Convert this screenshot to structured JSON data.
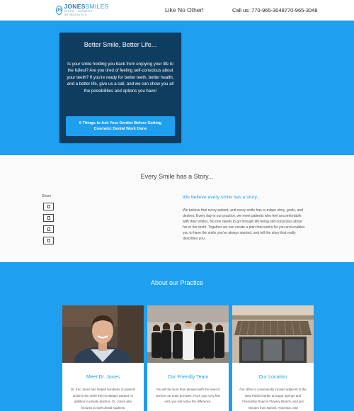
{
  "header": {
    "logo": {
      "name_bold": "JONES",
      "name_light": "SMILES",
      "tagline_small": "DENTAL · COSMETIC · ORTHODONTICS"
    },
    "tagline": "Like No Other!",
    "phone": "Call us: 770-965-3048770-965-3048"
  },
  "hero": {
    "title": "Better Smile, Better Life...",
    "text": "Is your smile holding you back from enjoying your life to the fullest? Are you tired of feeling self-conscious about your teeth? If you're ready for better teeth, better health, and a better life, give us a call, and we can show you all the possibilities and options you have!",
    "button_label": "6 Things to Ask Your Dentist Before Getting Cosmetic Dental Work Done"
  },
  "story": {
    "title": "Every Smile has a Story...",
    "share_label": "Share",
    "share_buttons": [
      "facebook-icon",
      "twitter-icon",
      "google-plus-icon",
      "email-icon"
    ],
    "subtitle": "We believe every smile has a story...",
    "text": "We believe that every patient, and every smile has a unique story, goals, and desires. Every day in our practice, we meet patients who feel uncomfortable with their smiles. No one needs to go through life being self-conscious about his or her teeth. Together we can create a plan that works for you and enables you to have the smile you've always wanted, and tell the story that really describes you."
  },
  "practice": {
    "title": "About our Practice",
    "cards": [
      {
        "title": "Meet Dr. Jones",
        "text": "Dr. Eric Jones has helped hundreds of patients achieve the smile they've always wanted. In addition to private practice, Dr. Jones also lectures to both dental students"
      },
      {
        "title": "Our Friendly Team",
        "text": "You will be more than pleased with the level of service our team provides. From your very first visit, you will notice the difference."
      },
      {
        "title": "Our Location",
        "text": "Our office is conveniently located adjacent to the New Publix market at Sugar Springs and Friendship Road in Flowery Branch, and just minutes from Buford, Hoschton, and"
      }
    ]
  },
  "colors": {
    "accent": "#1e9ff0",
    "hero_card": "#0f3d60"
  }
}
